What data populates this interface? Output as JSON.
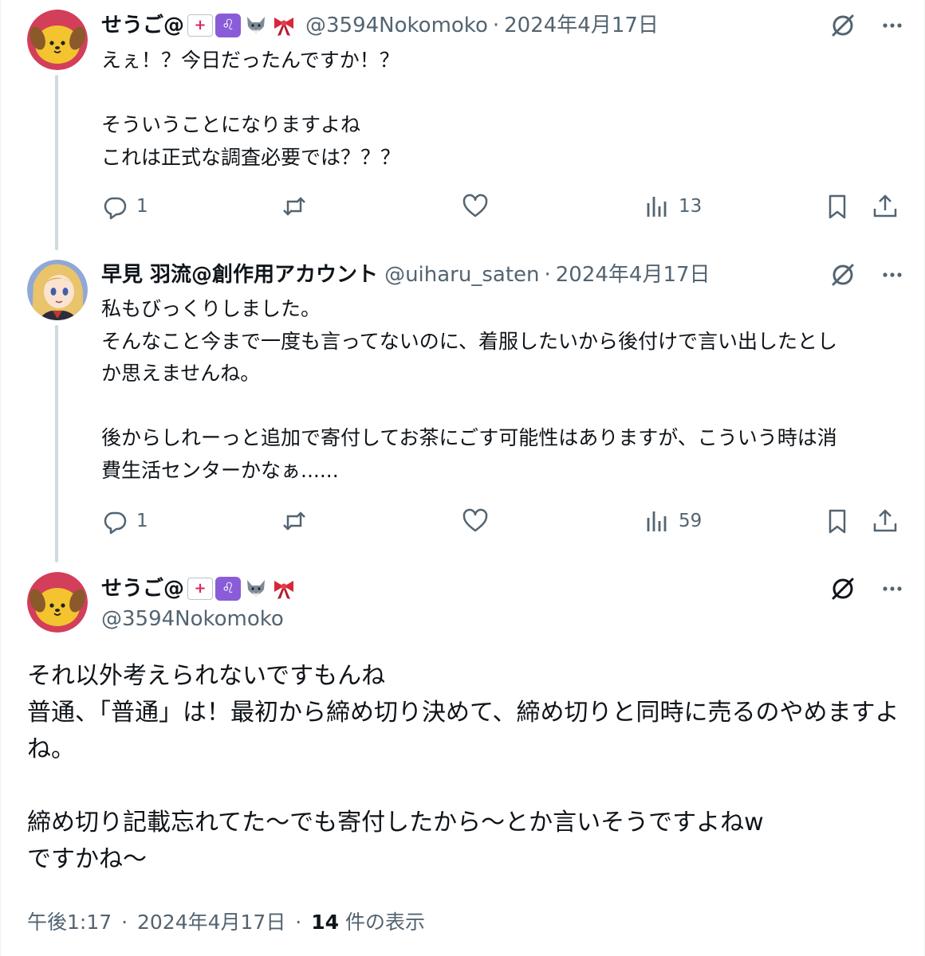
{
  "replies": [
    {
      "display_name": "せうご@",
      "badges": [
        "ambulance",
        "leo",
        "wolf",
        "ribbon"
      ],
      "handle": "@3594Nokomoko",
      "separator": "·",
      "date": "2024年4月17日",
      "text": "えぇ！？今日だったんですか！？\n\nそういうことになりますよね\nこれは正式な調査必要では？？？",
      "reply_count": "1",
      "views": "13"
    },
    {
      "display_name": "早見 羽流@創作用アカウント",
      "handle": "@uiharu_saten",
      "separator": "·",
      "date": "2024年4月17日",
      "text": "私もびっくりしました。\nそんなこと今まで一度も言ってないのに、着服したいから後付けで言い出したとし\nか思えませんね。\n\n後からしれーっと追加で寄付してお茶にごす可能性はありますが、こういう時は消\n費生活センターかなぁ......",
      "reply_count": "1",
      "views": "59"
    }
  ],
  "main_post": {
    "display_name": "せうご@",
    "badges": [
      "ambulance",
      "leo",
      "wolf",
      "ribbon"
    ],
    "handle": "@3594Nokomoko",
    "text": "それ以外考えられないですもんね\n普通、「普通」は！最初から締め切り決めて、締め切りと同時に売るのやめますよ\nね。\n\n締め切り記載忘れてた〜でも寄付したから〜とか言いそうですよねw\nですかね〜",
    "time": "午後1:17",
    "separator": "·",
    "date": "2024年4月17日",
    "views_count": "14",
    "views_label": " 件の表示"
  },
  "icons": [
    "grok-icon",
    "more-icon",
    "reply-icon",
    "retweet-icon",
    "like-icon",
    "views-icon",
    "bookmark-icon",
    "share-icon"
  ],
  "colors": {
    "text": "#0f1419",
    "secondary": "#536471",
    "thread_line": "#cfd9de",
    "avatar_ring": "#d33e5a",
    "dog_face": "#f3c42f"
  }
}
